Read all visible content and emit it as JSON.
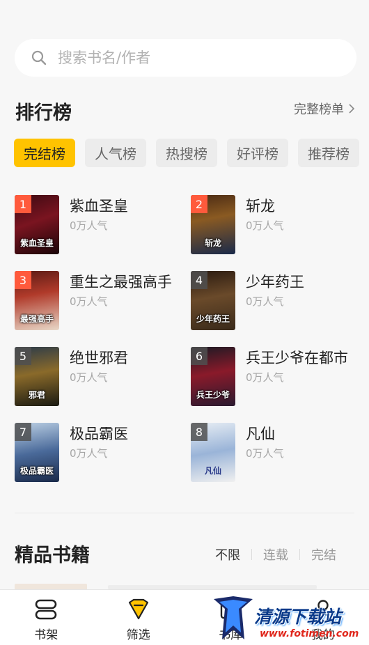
{
  "search": {
    "placeholder": "搜索书名/作者",
    "value": ""
  },
  "ranking": {
    "title": "排行榜",
    "full_list_label": "完整榜单",
    "tabs": [
      "完结榜",
      "人气榜",
      "热搜榜",
      "好评榜",
      "推荐榜"
    ],
    "active_tab": "完结榜",
    "books": [
      {
        "rank": "1",
        "title": "紫血圣皇",
        "popularity": "0万人气",
        "cover_text": "紫血圣皇"
      },
      {
        "rank": "2",
        "title": "斩龙",
        "popularity": "0万人气",
        "cover_text": "斩龙"
      },
      {
        "rank": "3",
        "title": "重生之最强高手",
        "popularity": "0万人气",
        "cover_text": "最强高手"
      },
      {
        "rank": "4",
        "title": "少年药王",
        "popularity": "0万人气",
        "cover_text": "少年药王"
      },
      {
        "rank": "5",
        "title": "绝世邪君",
        "popularity": "0万人气",
        "cover_text": "邪君"
      },
      {
        "rank": "6",
        "title": "兵王少爷在都市",
        "popularity": "0万人气",
        "cover_text": "兵王少爷"
      },
      {
        "rank": "7",
        "title": "极品霸医",
        "popularity": "0万人气",
        "cover_text": "极品霸医"
      },
      {
        "rank": "8",
        "title": "凡仙",
        "popularity": "0万人气",
        "cover_text": "凡仙"
      }
    ]
  },
  "featured": {
    "title": "精品书籍",
    "filters": [
      "不限",
      "连载",
      "完结"
    ],
    "active_filter": "不限"
  },
  "bottom_nav": {
    "items": [
      {
        "label": "书架",
        "icon": "bookshelf-icon"
      },
      {
        "label": "筛选",
        "icon": "filter-icon"
      },
      {
        "label": "书库",
        "icon": "library-icon"
      },
      {
        "label": "我的",
        "icon": "profile-icon"
      }
    ]
  },
  "watermark": {
    "text": "清源下载站",
    "url": "www.fotimen.com"
  },
  "colors": {
    "accent": "#ffc300",
    "rank_top": "#ff5a3c",
    "background": "#f7f7f7"
  }
}
